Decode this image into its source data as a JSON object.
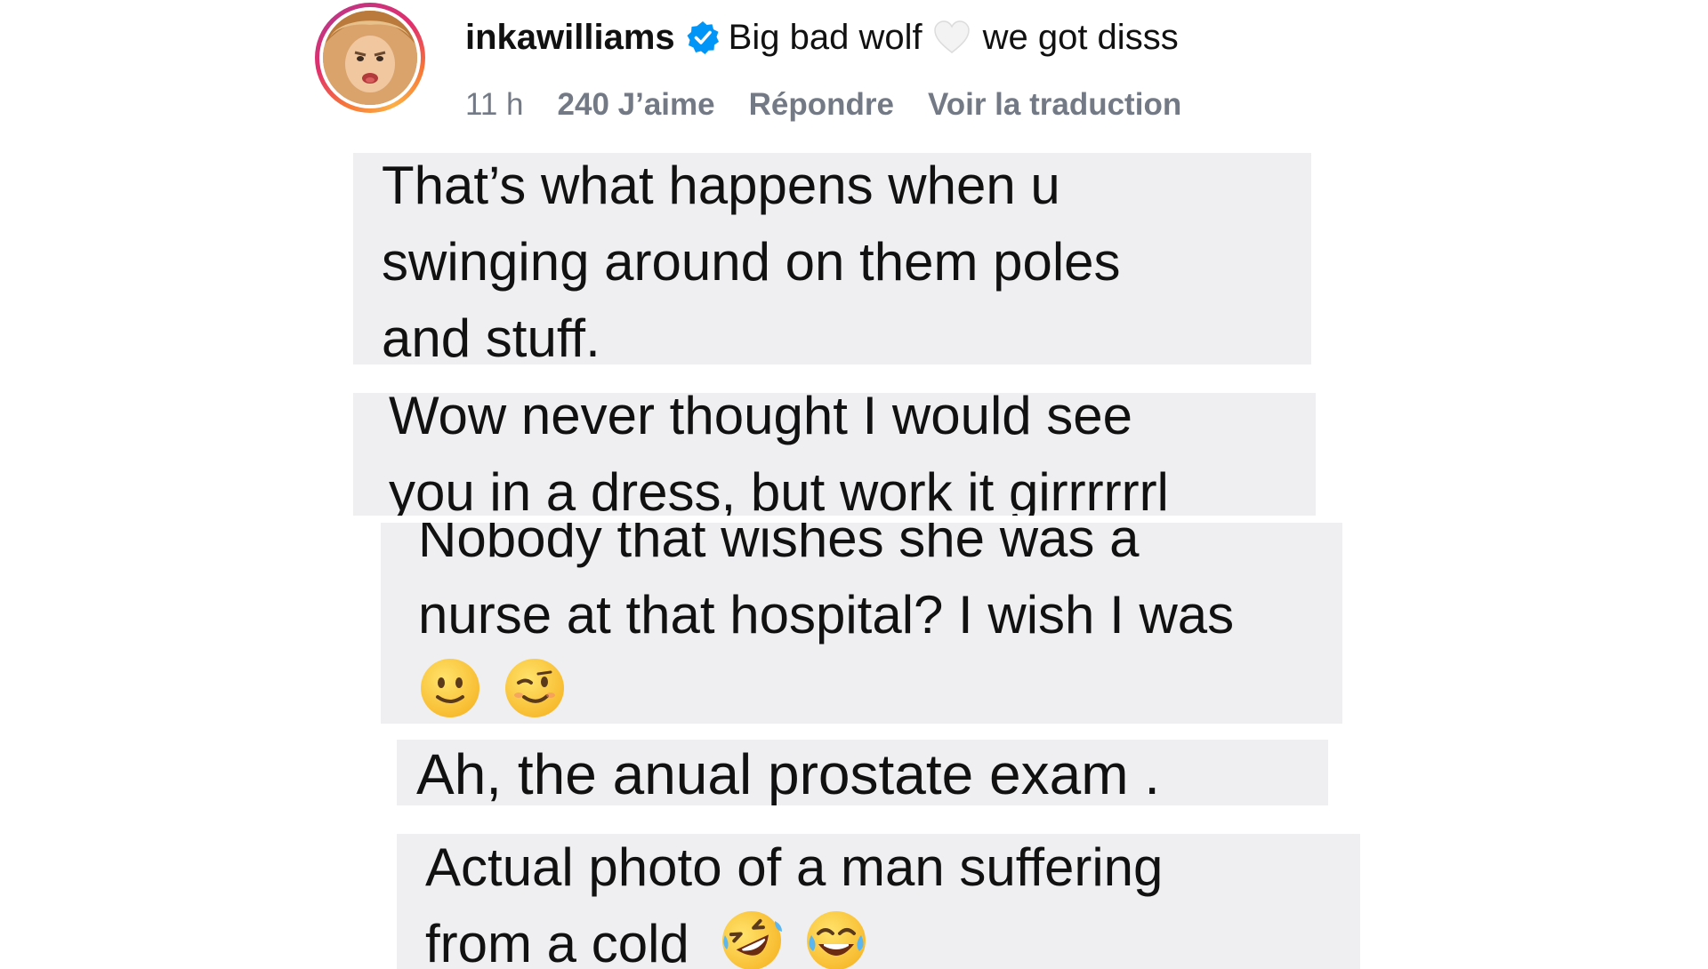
{
  "comment": {
    "username": "inkawilliams",
    "text_before_icon": "Big bad wolf",
    "text_after_icon": "we got disss",
    "timestamp": "11 h",
    "likes": "240 J’aime",
    "reply_label": "Répondre",
    "translate_label": "Voir la traduction",
    "icons": [
      "verified-badge-icon",
      "white-heart-icon"
    ]
  },
  "replies": [
    {
      "lines": [
        "That’s what happens when u",
        "swinging around on them poles",
        "and stuff."
      ]
    },
    {
      "lines": [
        "Wow never thought I would see",
        "you in a dress, but work it girrrrrrl"
      ]
    },
    {
      "lines": [
        "Nobody that wishes she was a",
        "nurse at that hospital? I wish I was"
      ],
      "emojis": [
        "slightly-smiling-face-icon",
        "winking-face-icon"
      ]
    },
    {
      "lines": [
        "Ah, the anual prostate exam ."
      ]
    },
    {
      "lines": [
        "Actual photo of a man suffering",
        "from a cold"
      ],
      "emojis": [
        "rolling-on-floor-laughing-icon",
        "tears-of-joy-icon"
      ]
    }
  ],
  "colors": {
    "reply_background": "#efeff2",
    "meta_text": "#737a86",
    "verified_blue": "#0095f6"
  }
}
